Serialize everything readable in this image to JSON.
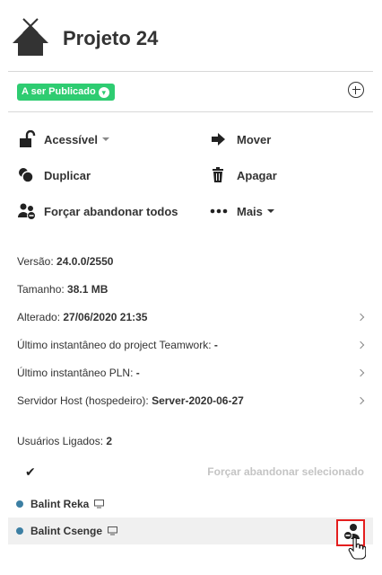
{
  "project": {
    "title": "Projeto 24"
  },
  "status": {
    "label": "A ser Publicado"
  },
  "actions": {
    "accessible": "Acessível",
    "move": "Mover",
    "duplicate": "Duplicar",
    "delete": "Apagar",
    "force_release_all": "Forçar abandonar todos",
    "more": "Mais"
  },
  "info": {
    "version_label": "Versão:",
    "version_value": "24.0.0/2550",
    "size_label": "Tamanho:",
    "size_value": "38.1 MB",
    "modified_label": "Alterado:",
    "modified_value": "27/06/2020 21:35",
    "teamwork_snapshot_label": "Último instantâneo do project Teamwork:",
    "teamwork_snapshot_value": "-",
    "pln_snapshot_label": "Último instantâneo PLN:",
    "pln_snapshot_value": "-",
    "host_label": "Servidor Host (hospedeiro):",
    "host_value": "Server-2020-06-27"
  },
  "users": {
    "header_label": "Usuários Ligados:",
    "count": "2",
    "force_selected_label": "Forçar abandonar selecionado",
    "list": [
      {
        "name": "Balint Reka"
      },
      {
        "name": "Balint Csenge"
      }
    ]
  },
  "colors": {
    "status_green": "#2ecc71",
    "user_dot": "#3c7fa3",
    "highlight": "#e41e1e"
  }
}
